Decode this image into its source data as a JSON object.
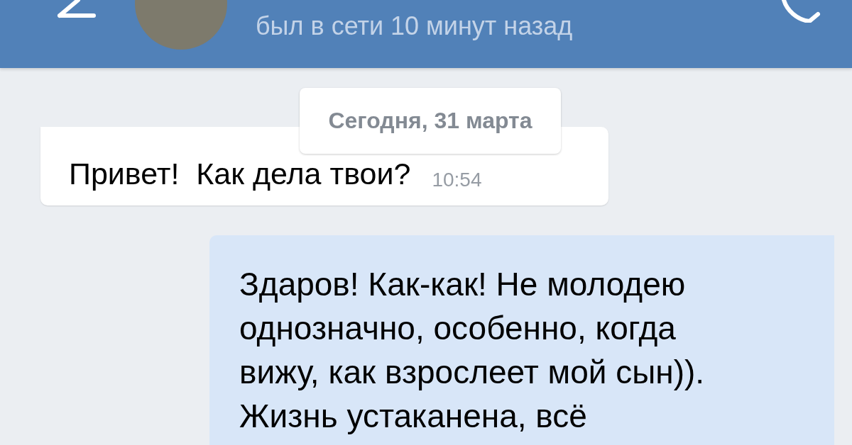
{
  "header": {
    "status": "был в сети 10 минут назад"
  },
  "date_separator": "Сегодня, 31 марта",
  "messages": [
    {
      "kind": "incoming",
      "text": "Привет!  Как дела твои?",
      "time": "10:54"
    },
    {
      "kind": "outgoing",
      "text": "Здаров! Как-как! Не молодею однозначно, особенно, когда вижу, как взрослеет мой сын)). Жизнь устаканена, всё"
    }
  ]
}
